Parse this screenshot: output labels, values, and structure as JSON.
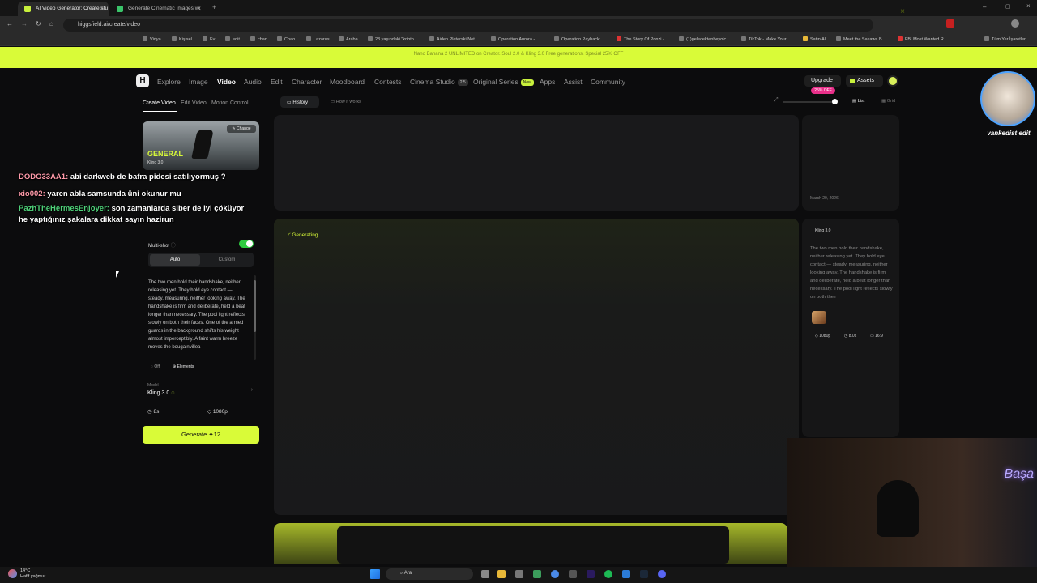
{
  "browser": {
    "tabs": [
      {
        "title": "AI Video Generator: Create stu",
        "active": true
      },
      {
        "title": "Generate Cinematic Images wi",
        "active": false
      }
    ],
    "url": "higgsfield.ai/create/video",
    "bookmarks": [
      "Vidya",
      "Kişisel",
      "Ev",
      "edit",
      "chan",
      "Chao",
      "Lazarus",
      "Araba",
      "23 yaşındaki \"kripto...",
      "Aiden Pleterski Net...",
      "Operation Aurora -...",
      "Operation Payback...",
      "The Story Of Ponzi -...",
      "(1)gelecektenbeyolc...",
      "TikTok - Make Your...",
      "Satın Al",
      "Meet the Sakawa B...",
      "FBI Most Wanted R...",
      "Tüm Yer İşaretleri"
    ]
  },
  "promo": {
    "text": "Nano Banana 2 UNLIMITED on Creator. Soul 2.0 & Kling 3.0 Free generations. Special 25% OFF"
  },
  "nav": {
    "logo": "H",
    "items": [
      "Explore",
      "Image",
      "Video",
      "Audio",
      "Edit",
      "Character",
      "Moodboard",
      "Contests",
      "Cinema Studio",
      "Original Series",
      "Apps",
      "Assist",
      "Community"
    ],
    "active": "Video",
    "cinema_badge": "2.5",
    "series_badge": "New",
    "upgrade": "Upgrade",
    "upgrade_badge": "25% OFF",
    "assets": "Assets"
  },
  "left": {
    "subtabs": [
      "Create Video",
      "Edit Video",
      "Motion Control"
    ],
    "card_title": "GENERAL",
    "card_sub": "Kling 3.0",
    "change": "Change",
    "multishot": "Multi-shot",
    "seg_auto": "Auto",
    "seg_custom": "Custom",
    "prompt": "The two men hold their handshake, neither releasing yet. They hold eye contact — steady, measuring, neither looking away. The handshake is firm and deliberate, held a beat longer than necessary. The pool light reflects slowly on both their faces. One of the armed guards in the background shifts his weight almost imperceptibly. A faint warm breeze moves the bougainvillea",
    "chip_off": "Off",
    "chip_elements": "Elements",
    "model_label": "Model",
    "model_value": "Kling 3.0",
    "duration": "8s",
    "resolution": "1080p",
    "generate": "Generate",
    "generate_cost": "12"
  },
  "chat": [
    {
      "user": "DODO33AA1:",
      "msg": " abi darkweb de bafra pidesi satılıyormuş ?"
    },
    {
      "user": "xio002:",
      "msg": " yaren abla samsunda üni okunur mu"
    },
    {
      "user": "PazhTheHermesEnjoyer:",
      "msg": " son zamanlarda siber de iyi çöküyor"
    },
    {
      "user": "",
      "msg": "he yaptığınız şakalara dikkat sayın hazirun"
    }
  ],
  "history": {
    "history_tab": "History",
    "how_tab": "How it works",
    "list": "List",
    "grid": "Grid",
    "generating": "Generating",
    "date": "March 20, 2026",
    "side_model": "Kling 3.0",
    "side_prompt": "The two men hold their handshake, neither releasing yet. They hold eye contact — steady, measuring, neither looking away. The handshake is firm and deliberate, held a beat longer than necessary. The pool light reflects slowly on both their",
    "meta_res": "1080p",
    "meta_dur": "8.0s",
    "meta_ratio": "16:9"
  },
  "stream": {
    "avatar_name": "vankedist edit",
    "neon": "Başa"
  },
  "taskbar": {
    "temp": "14°C",
    "weather": "Hafif yağmur",
    "search": "Ara"
  },
  "colors": {
    "accent": "#d9fb38",
    "toggle": "#2ecc40",
    "badge": "#e9308a"
  }
}
